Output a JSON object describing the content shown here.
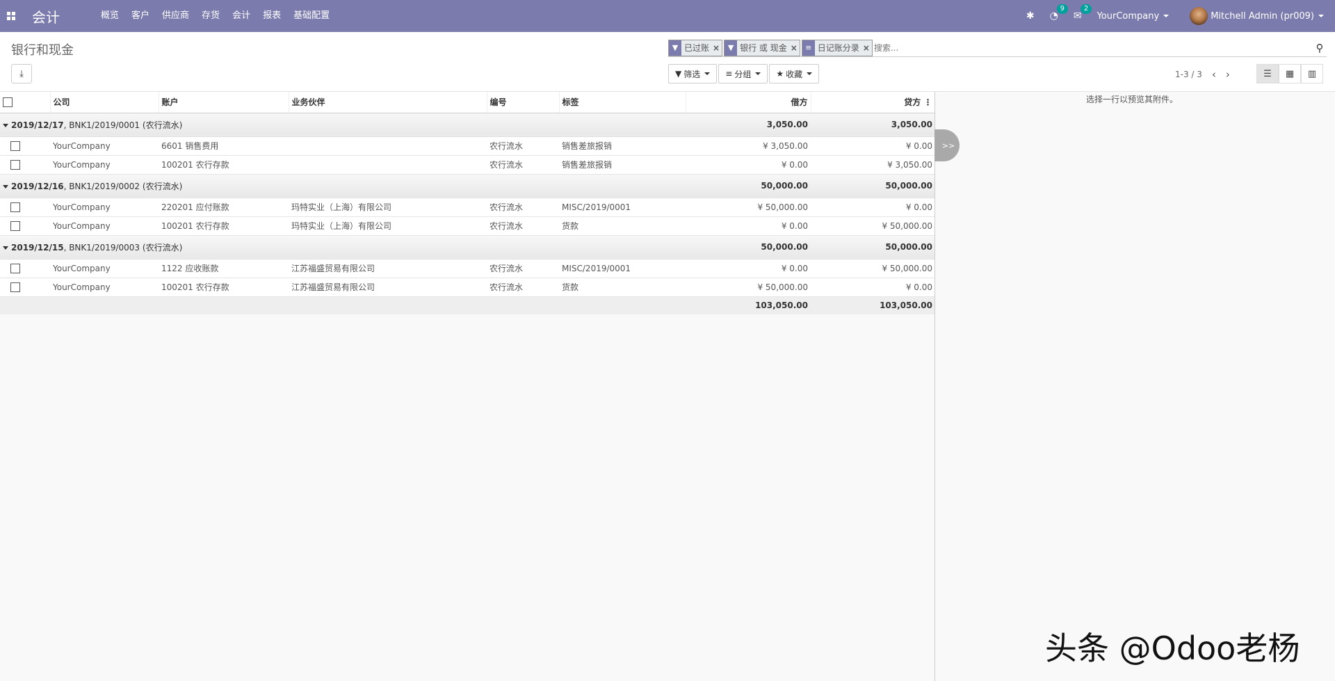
{
  "navbar": {
    "app_title": "会计",
    "menu": [
      "概览",
      "客户",
      "供应商",
      "存货",
      "会计",
      "报表",
      "基础配置"
    ],
    "activity_count": "9",
    "message_count": "2",
    "company": "YourCompany",
    "user": "Mitchell Admin (pr009)"
  },
  "control_panel": {
    "breadcrumb": "银行和现金",
    "search": {
      "facets": [
        {
          "icon": "filter-icon",
          "label": "已过账"
        },
        {
          "icon": "filter-icon",
          "label": "银行 或 现金"
        },
        {
          "icon": "group-icon",
          "label": "日记账分录"
        }
      ],
      "placeholder": "搜索..."
    },
    "filter_label": "筛选",
    "group_label": "分组",
    "favorite_label": "收藏",
    "pager": "1-3 / 3"
  },
  "columns": [
    "公司",
    "账户",
    "业务伙伴",
    "编号",
    "标签",
    "借方",
    "贷方"
  ],
  "groups": [
    {
      "date": "2019/12/17",
      "rest": ", BNK1/2019/0001    (农行流水)",
      "debit": "3,050.00",
      "credit": "3,050.00",
      "rows": [
        {
          "company": "YourCompany",
          "account": "6601 销售费用",
          "partner": "",
          "ref": "农行流水",
          "label": "销售差旅报销",
          "debit": "¥ 3,050.00",
          "credit": "¥ 0.00"
        },
        {
          "company": "YourCompany",
          "account": "100201 农行存款",
          "partner": "",
          "ref": "农行流水",
          "label": "销售差旅报销",
          "debit": "¥ 0.00",
          "credit": "¥ 3,050.00"
        }
      ]
    },
    {
      "date": "2019/12/16",
      "rest": ", BNK1/2019/0002    (农行流水)",
      "debit": "50,000.00",
      "credit": "50,000.00",
      "rows": [
        {
          "company": "YourCompany",
          "account": "220201 应付账款",
          "partner": "玛特实业（上海）有限公司",
          "ref": "农行流水",
          "label": "MISC/2019/0001",
          "debit": "¥ 50,000.00",
          "credit": "¥ 0.00"
        },
        {
          "company": "YourCompany",
          "account": "100201 农行存款",
          "partner": "玛特实业（上海）有限公司",
          "ref": "农行流水",
          "label": "货款",
          "debit": "¥ 0.00",
          "credit": "¥ 50,000.00"
        }
      ]
    },
    {
      "date": "2019/12/15",
      "rest": ", BNK1/2019/0003    (农行流水)",
      "debit": "50,000.00",
      "credit": "50,000.00",
      "rows": [
        {
          "company": "YourCompany",
          "account": "1122 应收账款",
          "partner": "江苏福盛贸易有限公司",
          "ref": "农行流水",
          "label": "MISC/2019/0001",
          "debit": "¥ 0.00",
          "credit": "¥ 50,000.00"
        },
        {
          "company": "YourCompany",
          "account": "100201 农行存款",
          "partner": "江苏福盛贸易有限公司",
          "ref": "农行流水",
          "label": "货款",
          "debit": "¥ 50,000.00",
          "credit": "¥ 0.00"
        }
      ]
    }
  ],
  "totals": {
    "debit": "103,050.00",
    "credit": "103,050.00"
  },
  "preview": {
    "message": "选择一行以预览其附件。",
    "toggle": ">>"
  },
  "watermark": "头条 @Odoo老杨"
}
